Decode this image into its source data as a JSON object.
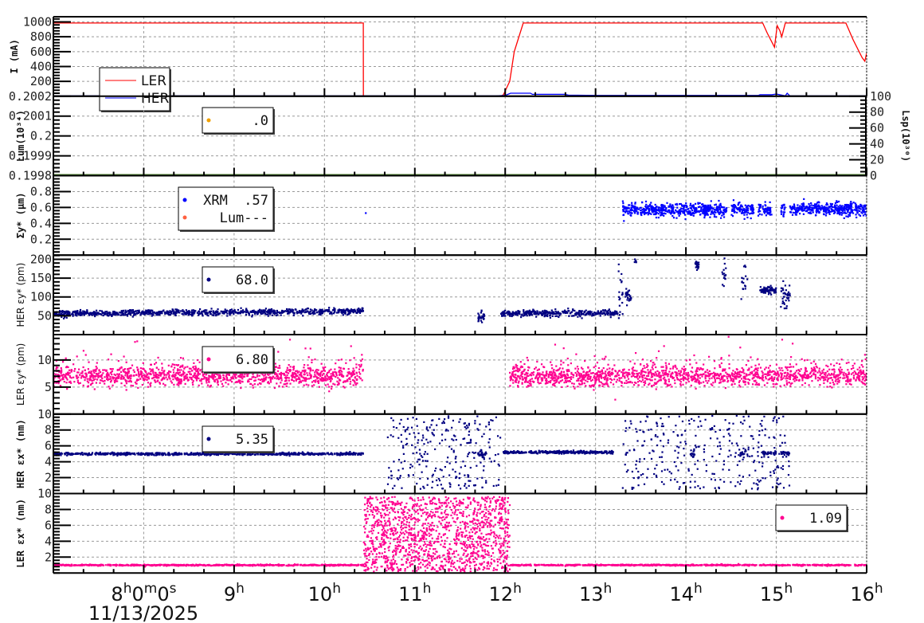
{
  "chart_data": {
    "type": "scatter",
    "title": "",
    "x_axis": {
      "unit": "hour",
      "xlim": [
        7,
        16
      ],
      "ticks": [
        8,
        9,
        10,
        11,
        12,
        13,
        14,
        15,
        16
      ],
      "tick_labels": [
        "8h0m0s",
        "9h",
        "10h",
        "11h",
        "12h",
        "13h",
        "14h",
        "15h",
        "16h"
      ],
      "date_label": "11/13/2025",
      "grid": true
    },
    "panels": [
      {
        "id": "current",
        "ylabel": "I (mA)",
        "ylim": [
          0,
          1070
        ],
        "yticks": [
          200,
          400,
          600,
          800,
          1000
        ],
        "ytick_labels": [
          "200",
          "400",
          "600",
          "800",
          "1000"
        ],
        "legend": {
          "entries": [
            {
              "label": "LER",
              "color": "#ff0000",
              "marker": "line"
            },
            {
              "label": "HER",
              "color": "#0000ff",
              "marker": "line"
            }
          ]
        },
        "lines": [
          {
            "name": "LER",
            "color": "#ff0000",
            "x": [
              7.0,
              10.43,
              10.431,
              11.95,
              11.98,
              12.05,
              12.1,
              12.2,
              14.85,
              14.9,
              14.98,
              15.01,
              15.04,
              15.06,
              15.1,
              15.77,
              15.85,
              15.95,
              15.98,
              16.0
            ],
            "y": [
              985,
              985,
              0,
              0,
              20,
              200,
              600,
              985,
              985,
              850,
              660,
              950,
              880,
              800,
              985,
              985,
              760,
              520,
              470,
              580
            ]
          },
          {
            "name": "HER",
            "color": "#0000ff",
            "x": [
              7.0,
              10.43,
              11.9,
              12.0,
              12.06,
              12.28,
              12.3,
              12.66,
              12.7,
              13.0,
              14.2,
              14.25,
              14.8,
              14.82,
              14.95,
              15.0,
              15.1,
              15.12,
              15.15,
              16.0
            ],
            "y": [
              5,
              5,
              5,
              10,
              40,
              40,
              25,
              25,
              15,
              10,
              10,
              10,
              10,
              20,
              20,
              30,
              5,
              40,
              5,
              5
            ]
          }
        ]
      },
      {
        "id": "luminosity",
        "ylabel": "Lum(10³⁴)",
        "ylim": [
          0.1998,
          0.2002
        ],
        "yticks": [
          0.1998,
          0.1999,
          0.2,
          0.2001,
          0.2002
        ],
        "ytick_labels": [
          "0.1998",
          "0.1999",
          "0.2",
          "0.2001",
          "0.2002"
        ],
        "right_axis": {
          "label": "Lsp(10³⁰)",
          "ylim": [
            0,
            100
          ],
          "yticks": [
            0,
            20,
            40,
            60,
            80,
            100
          ],
          "ytick_labels": [
            "0",
            "20",
            "40",
            "60",
            "80",
            "100"
          ]
        },
        "legend": {
          "entries": [
            {
              "label": ".0",
              "color": "#f0a000",
              "marker": "dot"
            }
          ]
        },
        "segments": [],
        "baseline_color": "#4a7a2a"
      },
      {
        "id": "sigma_y",
        "ylabel": "Σy* (µm)",
        "ylim": [
          0,
          1
        ],
        "yticks": [
          0.2,
          0.4,
          0.6,
          0.8
        ],
        "ytick_labels": [
          "0.2",
          "0.4",
          "0.6",
          "0.8"
        ],
        "legend": {
          "entries": [
            {
              "label": "XRM  .57",
              "color": "#0000ff",
              "marker": "dot"
            },
            {
              "label": "Lum---",
              "color": "#ff6040",
              "marker": "dot"
            }
          ]
        },
        "color": "#0000ff",
        "segments": [
          {
            "t": [
              10.45,
              10.46
            ],
            "n": 1,
            "mean": 0.53,
            "sd": 0
          },
          {
            "t": [
              13.3,
              14.45
            ],
            "n": 500,
            "mean": 0.57,
            "sd": 0.04
          },
          {
            "t": [
              14.5,
              14.75
            ],
            "n": 100,
            "mean": 0.57,
            "sd": 0.04
          },
          {
            "t": [
              14.8,
              14.95
            ],
            "n": 60,
            "mean": 0.57,
            "sd": 0.04
          },
          {
            "t": [
              15.05,
              15.1
            ],
            "n": 20,
            "mean": 0.57,
            "sd": 0.04
          },
          {
            "t": [
              15.15,
              16.0
            ],
            "n": 380,
            "mean": 0.58,
            "sd": 0.04
          }
        ]
      },
      {
        "id": "her_eps_y",
        "ylabel": "HER εy* (pm)",
        "ylim": [
          0,
          211
        ],
        "yticks": [
          50,
          100,
          150,
          200
        ],
        "ytick_labels": [
          "50",
          "100",
          "150",
          "200"
        ],
        "legend": {
          "entries": [
            {
              "label": "68.0",
              "color": "#000080",
              "marker": "dot"
            }
          ]
        },
        "color": "#000080",
        "segments": [
          {
            "t": [
              7.0,
              10.43
            ],
            "n": 900,
            "mean": 56,
            "sd": 4,
            "trend": 6
          },
          {
            "t": [
              11.7,
              11.77
            ],
            "n": 30,
            "mean": 45,
            "sd": 8
          },
          {
            "t": [
              11.95,
              13.25
            ],
            "n": 380,
            "mean": 57,
            "sd": 4
          },
          {
            "t": [
              13.25,
              13.3
            ],
            "n": 20,
            "mean": 120,
            "sd": 40
          },
          {
            "t": [
              13.33,
              13.4
            ],
            "n": 30,
            "mean": 105,
            "sd": 8
          },
          {
            "t": [
              13.43,
              13.45
            ],
            "n": 6,
            "mean": 195,
            "sd": 5
          },
          {
            "t": [
              14.1,
              14.15
            ],
            "n": 20,
            "mean": 185,
            "sd": 10
          },
          {
            "t": [
              14.4,
              14.45
            ],
            "n": 15,
            "mean": 170,
            "sd": 25
          },
          {
            "t": [
              14.6,
              14.68
            ],
            "n": 18,
            "mean": 160,
            "sd": 35
          },
          {
            "t": [
              14.82,
              15.0
            ],
            "n": 80,
            "mean": 118,
            "sd": 5
          },
          {
            "t": [
              15.05,
              15.15
            ],
            "n": 40,
            "mean": 100,
            "sd": 20
          }
        ]
      },
      {
        "id": "ler_eps_y",
        "ylabel": "LER εy* (pm)",
        "ylim": [
          0,
          14.7
        ],
        "yticks": [
          5,
          10
        ],
        "ytick_labels": [
          "5",
          "10"
        ],
        "legend": {
          "entries": [
            {
              "label": "6.80",
              "color": "#ff0090",
              "marker": "dot"
            }
          ]
        },
        "color": "#ff0090",
        "segments": [
          {
            "t": [
              7.0,
              10.43
            ],
            "n": 1300,
            "mean": 7.0,
            "sd": 0.9,
            "skew": true
          },
          {
            "t": [
              12.05,
              16.0
            ],
            "n": 1500,
            "mean": 7.0,
            "sd": 0.9,
            "skew": true
          }
        ]
      },
      {
        "id": "her_eps_x",
        "ylabel": "HER εx* (nm)",
        "ylim": [
          0,
          10
        ],
        "yticks": [
          2,
          4,
          6,
          8,
          10
        ],
        "ytick_labels": [
          "2",
          "4",
          "6",
          "8",
          "10"
        ],
        "legend": {
          "entries": [
            {
              "label": "5.35",
              "color": "#000080",
              "marker": "dot"
            }
          ]
        },
        "color": "#000080",
        "segments": [
          {
            "t": [
              7.0,
              10.43
            ],
            "n": 700,
            "mean": 5.0,
            "sd": 0.08
          },
          {
            "t": [
              10.7,
              11.95
            ],
            "n": 260,
            "mean": 3.5,
            "sd": 2.0,
            "uniform": [
              0.5,
              9.8
            ]
          },
          {
            "t": [
              11.7,
              11.78
            ],
            "n": 30,
            "mean": 4.9,
            "sd": 0.3
          },
          {
            "t": [
              11.98,
              13.2
            ],
            "n": 350,
            "mean": 5.2,
            "sd": 0.08
          },
          {
            "t": [
              13.3,
              15.15
            ],
            "n": 320,
            "mean": 3.5,
            "sd": 2.0,
            "uniform": [
              0.5,
              9.8
            ]
          },
          {
            "t": [
              14.05,
              14.1
            ],
            "n": 15,
            "mean": 5.0,
            "sd": 0.3
          },
          {
            "t": [
              14.6,
              14.68
            ],
            "n": 15,
            "mean": 5.1,
            "sd": 0.3
          },
          {
            "t": [
              14.85,
              15.0
            ],
            "n": 40,
            "mean": 5.1,
            "sd": 0.1
          },
          {
            "t": [
              15.05,
              15.15
            ],
            "n": 25,
            "mean": 5.1,
            "sd": 0.1
          }
        ]
      },
      {
        "id": "ler_eps_x",
        "ylabel": "LER εx* (nm)",
        "ylim": [
          0,
          10
        ],
        "yticks": [
          2,
          4,
          6,
          8,
          10
        ],
        "ytick_labels": [
          "2",
          "4",
          "6",
          "8",
          "10"
        ],
        "legend": {
          "entries": [
            {
              "label": "1.09",
              "color": "#ff0090",
              "marker": "dot"
            }
          ]
        },
        "color": "#ff0090",
        "segments": [
          {
            "t": [
              7.0,
              10.43
            ],
            "n": 700,
            "mean": 1.0,
            "sd": 0.04
          },
          {
            "t": [
              10.43,
              12.05
            ],
            "n": 1400,
            "mean": 4.5,
            "sd": 2.0,
            "uniform": [
              0.2,
              9.6
            ]
          },
          {
            "t": [
              12.05,
              16.0
            ],
            "n": 800,
            "mean": 1.0,
            "sd": 0.04
          }
        ]
      }
    ]
  }
}
